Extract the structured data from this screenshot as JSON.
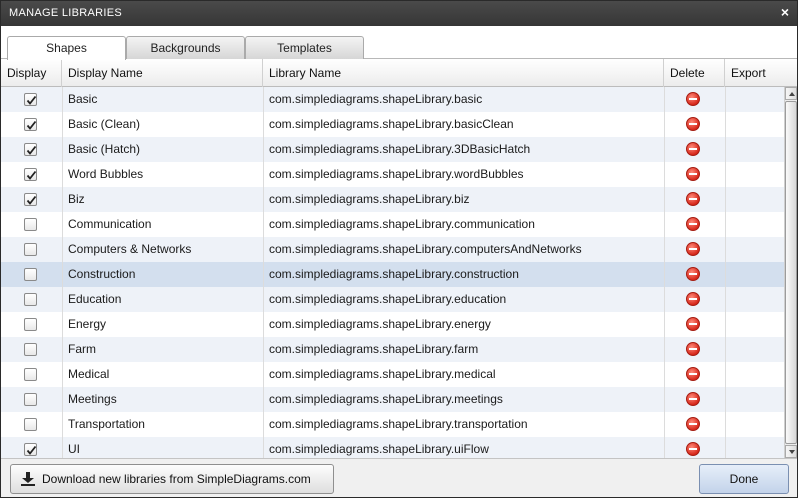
{
  "window": {
    "title": "MANAGE LIBRARIES",
    "close_glyph": "×"
  },
  "tabs": [
    {
      "label": "Shapes",
      "active": true
    },
    {
      "label": "Backgrounds",
      "active": false
    },
    {
      "label": "Templates",
      "active": false
    }
  ],
  "columns": {
    "display": "Display",
    "display_name": "Display Name",
    "library_name": "Library Name",
    "delete": "Delete",
    "export": "Export"
  },
  "rows": [
    {
      "checked": true,
      "name": "Basic",
      "library": "com.simplediagrams.shapeLibrary.basic"
    },
    {
      "checked": true,
      "name": "Basic (Clean)",
      "library": "com.simplediagrams.shapeLibrary.basicClean"
    },
    {
      "checked": true,
      "name": "Basic (Hatch)",
      "library": "com.simplediagrams.shapeLibrary.3DBasicHatch"
    },
    {
      "checked": true,
      "name": "Word Bubbles",
      "library": "com.simplediagrams.shapeLibrary.wordBubbles"
    },
    {
      "checked": true,
      "name": "Biz",
      "library": "com.simplediagrams.shapeLibrary.biz"
    },
    {
      "checked": false,
      "name": "Communication",
      "library": "com.simplediagrams.shapeLibrary.communication"
    },
    {
      "checked": false,
      "name": "Computers & Networks",
      "library": "com.simplediagrams.shapeLibrary.computersAndNetworks"
    },
    {
      "checked": false,
      "name": "Construction",
      "library": "com.simplediagrams.shapeLibrary.construction",
      "selected": true
    },
    {
      "checked": false,
      "name": "Education",
      "library": "com.simplediagrams.shapeLibrary.education"
    },
    {
      "checked": false,
      "name": "Energy",
      "library": "com.simplediagrams.shapeLibrary.energy"
    },
    {
      "checked": false,
      "name": "Farm",
      "library": "com.simplediagrams.shapeLibrary.farm"
    },
    {
      "checked": false,
      "name": "Medical",
      "library": "com.simplediagrams.shapeLibrary.medical"
    },
    {
      "checked": false,
      "name": "Meetings",
      "library": "com.simplediagrams.shapeLibrary.meetings"
    },
    {
      "checked": false,
      "name": "Transportation",
      "library": "com.simplediagrams.shapeLibrary.transportation"
    },
    {
      "checked": true,
      "name": "UI",
      "library": "com.simplediagrams.shapeLibrary.uiFlow"
    }
  ],
  "icons": {
    "delete": "delete-circle-icon",
    "download": "download-icon",
    "checkmark": "checkmark-icon"
  },
  "colors": {
    "delete_red": "#d7281b",
    "selected_row": "#d3dfee",
    "titlebar": "#3c3c3c"
  },
  "footer": {
    "download_label": "Download new libraries from SimpleDiagrams.com",
    "done_label": "Done"
  }
}
